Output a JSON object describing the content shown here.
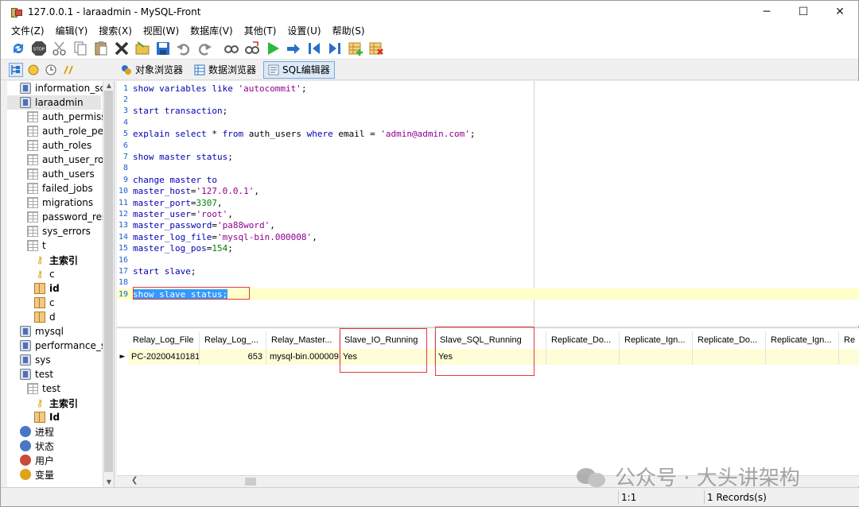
{
  "window": {
    "title": "127.0.0.1 - laraadmin - MySQL-Front",
    "controls": [
      "─",
      "☐",
      "✕"
    ]
  },
  "menu": [
    "文件(Z)",
    "编辑(Y)",
    "搜索(X)",
    "视图(W)",
    "数据库(V)",
    "其他(T)",
    "设置(U)",
    "帮助(S)"
  ],
  "toolbar_icons": [
    "refresh-icon",
    "stop-icon",
    "cut-icon",
    "copy-icon",
    "paste-icon",
    "delete-icon",
    "open-folder-icon",
    "save-icon",
    "undo-icon",
    "redo-icon",
    "search-icon",
    "replace-icon",
    "run-icon",
    "run-step-icon",
    "first-icon",
    "last-icon",
    "insert-record-icon",
    "delete-record-icon"
  ],
  "view_tabs": [
    {
      "label": "对象浏览器",
      "active": false
    },
    {
      "label": "数据浏览器",
      "active": false
    },
    {
      "label": "SQL编辑器",
      "active": true
    }
  ],
  "tree": [
    {
      "label": "information_schema",
      "type": "db",
      "indent": 0
    },
    {
      "label": "laraadmin",
      "type": "db",
      "indent": 0,
      "selected": true
    },
    {
      "label": "auth_permissions",
      "type": "tbl",
      "indent": 1
    },
    {
      "label": "auth_role_permissions",
      "type": "tbl",
      "indent": 1
    },
    {
      "label": "auth_roles",
      "type": "tbl",
      "indent": 1
    },
    {
      "label": "auth_user_roles",
      "type": "tbl",
      "indent": 1
    },
    {
      "label": "auth_users",
      "type": "tbl",
      "indent": 1
    },
    {
      "label": "failed_jobs",
      "type": "tbl",
      "indent": 1
    },
    {
      "label": "migrations",
      "type": "tbl",
      "indent": 1
    },
    {
      "label": "password_resets",
      "type": "tbl",
      "indent": 1
    },
    {
      "label": "sys_errors",
      "type": "tbl",
      "indent": 1
    },
    {
      "label": "t",
      "type": "tbl",
      "indent": 1
    },
    {
      "label": "主索引",
      "type": "key",
      "indent": 2,
      "bold": true
    },
    {
      "label": "c",
      "type": "key",
      "indent": 2
    },
    {
      "label": "id",
      "type": "col",
      "indent": 2,
      "bold": true
    },
    {
      "label": "c",
      "type": "col",
      "indent": 2
    },
    {
      "label": "d",
      "type": "col",
      "indent": 2
    },
    {
      "label": "mysql",
      "type": "db",
      "indent": 0
    },
    {
      "label": "performance_schema",
      "type": "db",
      "indent": 0
    },
    {
      "label": "sys",
      "type": "db",
      "indent": 0
    },
    {
      "label": "test",
      "type": "db",
      "indent": 0
    },
    {
      "label": "test",
      "type": "tbl",
      "indent": 1
    },
    {
      "label": "主索引",
      "type": "key",
      "indent": 2,
      "bold": true
    },
    {
      "label": "Id",
      "type": "col",
      "indent": 2,
      "bold": true
    },
    {
      "label": "进程",
      "type": "misc",
      "indent": 0
    },
    {
      "label": "状态",
      "type": "misc",
      "indent": 0
    },
    {
      "label": "用户",
      "type": "misc",
      "indent": 0
    },
    {
      "label": "变量",
      "type": "misc",
      "indent": 0
    }
  ],
  "editor": {
    "lines": [
      [
        [
          "kw",
          "show variables like "
        ],
        [
          "str",
          "'autocommit'"
        ],
        [
          "plain",
          ";"
        ]
      ],
      [],
      [
        [
          "kw",
          "start transaction"
        ],
        [
          "plain",
          ";"
        ]
      ],
      [],
      [
        [
          "kw",
          "explain select "
        ],
        [
          "plain",
          "* "
        ],
        [
          "kw",
          "from "
        ],
        [
          "plain",
          "auth_users "
        ],
        [
          "kw",
          "where "
        ],
        [
          "plain",
          "email = "
        ],
        [
          "str",
          "'admin@admin.com'"
        ],
        [
          "plain",
          ";"
        ]
      ],
      [],
      [
        [
          "kw",
          "show master status"
        ],
        [
          "plain",
          ";"
        ]
      ],
      [],
      [
        [
          "kw",
          "change master to"
        ]
      ],
      [
        [
          "kw",
          "master_host"
        ],
        [
          "plain",
          "="
        ],
        [
          "str",
          "'127.0.0.1'"
        ],
        [
          "plain",
          ","
        ]
      ],
      [
        [
          "kw",
          "master_port"
        ],
        [
          "plain",
          "="
        ],
        [
          "num",
          "3307"
        ],
        [
          "plain",
          ","
        ]
      ],
      [
        [
          "kw",
          "master_user"
        ],
        [
          "plain",
          "="
        ],
        [
          "str",
          "'root'"
        ],
        [
          "plain",
          ","
        ]
      ],
      [
        [
          "kw",
          "master_password"
        ],
        [
          "plain",
          "="
        ],
        [
          "str",
          "'pa88word'"
        ],
        [
          "plain",
          ","
        ]
      ],
      [
        [
          "kw",
          "master_log_file"
        ],
        [
          "plain",
          "="
        ],
        [
          "str",
          "'mysql-bin.000008'"
        ],
        [
          "plain",
          ","
        ]
      ],
      [
        [
          "kw",
          "master_log_pos"
        ],
        [
          "plain",
          "="
        ],
        [
          "num",
          "154"
        ],
        [
          "plain",
          ";"
        ]
      ],
      [],
      [
        [
          "kw",
          "start slave"
        ],
        [
          "plain",
          ";"
        ]
      ],
      [],
      [
        [
          "sel",
          "show slave status;"
        ]
      ]
    ],
    "current_line": 19
  },
  "grid": {
    "columns": [
      "Relay_Log_File",
      "Relay_Log_...",
      "Relay_Master...",
      "Slave_IO_Running",
      "Slave_SQL_Running",
      "Replicate_Do...",
      "Replicate_Ign...",
      "Replicate_Do...",
      "Replicate_Ign...",
      "Re"
    ],
    "rows": [
      [
        "PC-20200410181",
        "653",
        "mysql-bin.000009",
        "Yes",
        "Yes",
        "",
        "",
        "",
        "",
        ""
      ]
    ],
    "row_marker": "►"
  },
  "status": {
    "position": "1:1",
    "records": "1 Records(s)"
  },
  "watermark": "公众号 · 大头讲架构"
}
